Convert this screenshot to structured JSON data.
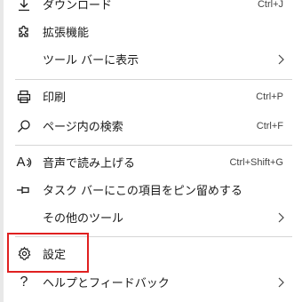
{
  "menu": {
    "items": [
      {
        "label": "ダウンロード",
        "shortcut": "Ctrl+J",
        "icon": "download-icon"
      },
      {
        "label": "拡張機能",
        "shortcut": "",
        "icon": "extensions-icon"
      },
      {
        "label": "ツール バーに表示",
        "shortcut": "",
        "icon": ""
      },
      {
        "label": "印刷",
        "shortcut": "Ctrl+P",
        "icon": "print-icon"
      },
      {
        "label": "ページ内の検索",
        "shortcut": "Ctrl+F",
        "icon": "search-icon"
      },
      {
        "label": "音声で読み上げる",
        "shortcut": "Ctrl+Shift+G",
        "icon": "read-aloud-icon",
        "icon_text": "A"
      },
      {
        "label": "タスク バーにこの項目をピン留めする",
        "shortcut": "",
        "icon": "pin-icon"
      },
      {
        "label": "その他のツール",
        "shortcut": "",
        "icon": ""
      },
      {
        "label": "設定",
        "shortcut": "",
        "icon": "gear-icon"
      },
      {
        "label": "ヘルプとフィードバック",
        "shortcut": "",
        "icon": "help-icon",
        "icon_text": "?"
      }
    ]
  },
  "highlight_color": "#e02020"
}
